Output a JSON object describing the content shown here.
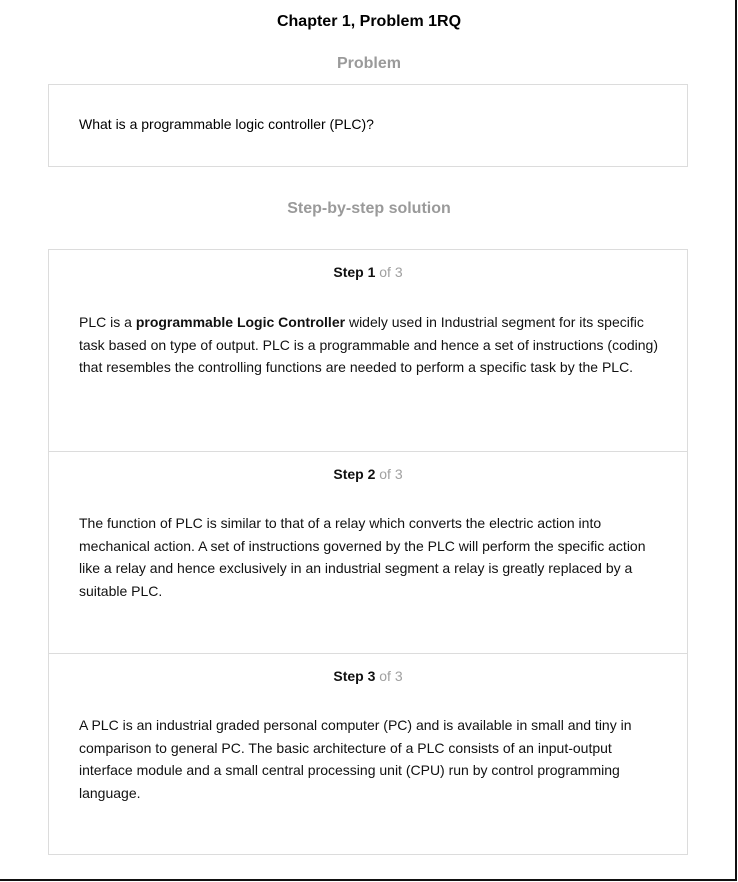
{
  "header": {
    "title": "Chapter 1, Problem 1RQ"
  },
  "problem": {
    "heading": "Problem",
    "text": "What is a programmable logic controller (PLC)?"
  },
  "solution": {
    "heading": "Step-by-step solution",
    "steps": [
      {
        "label": "Step 1",
        "of": "of 3",
        "text_before": "PLC is a ",
        "text_bold": "programmable Logic Controller",
        "text_after": " widely used in Industrial segment for its specific task based on type of output. PLC is a programmable and hence a set of instructions (coding) that resembles the controlling functions are needed to perform a specific task by the PLC."
      },
      {
        "label": "Step 2",
        "of": "of 3",
        "text": "The function of PLC is similar to that of a relay which converts the electric action into mechanical action. A set of instructions governed by the PLC will perform the specific action like a relay and hence exclusively in an industrial segment a relay is greatly replaced by a suitable PLC."
      },
      {
        "label": "Step 3",
        "of": "of 3",
        "text": "A PLC is an industrial graded personal computer (PC) and is available in small and tiny in comparison to general PC. The basic architecture of a PLC consists of an input-output interface module and a small central processing unit (CPU) run by control programming language."
      }
    ]
  }
}
